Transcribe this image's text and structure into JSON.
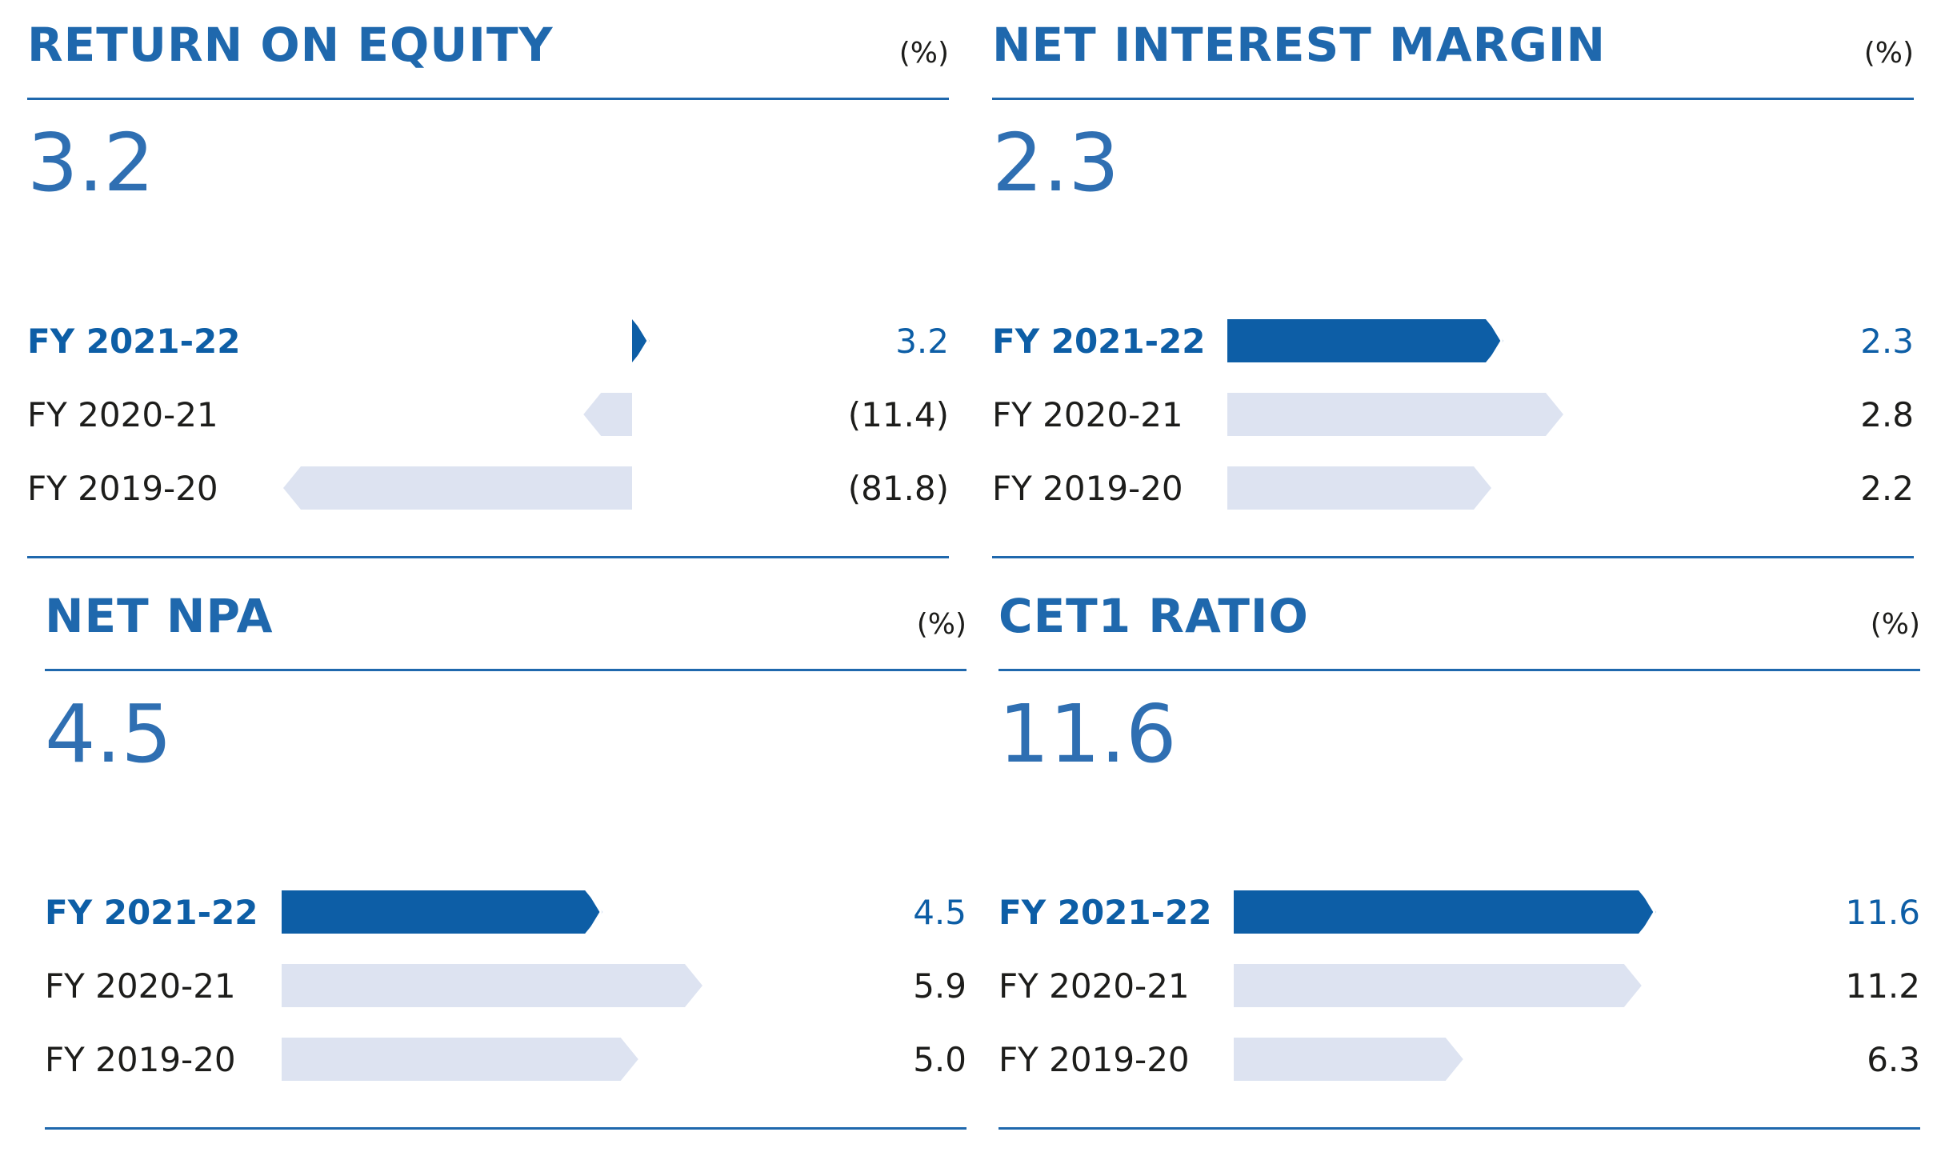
{
  "colors": {
    "accent": "#0d5ea6",
    "title": "#1f68ad",
    "kpi": "#2f6fb2",
    "bar_current": "#0d5ea6",
    "bar_past": "#dde3f1",
    "text_dark": "#1d1d1b",
    "rule": "#1f68ad"
  },
  "chart_data": [
    {
      "type": "bar",
      "title": "RETURN ON EQUITY",
      "unit": "(%)",
      "headline": "3.2",
      "categories": [
        "FY 2021-22",
        "FY 2020-21",
        "FY 2019-20"
      ],
      "values": [
        3.2,
        -11.4,
        -81.8
      ],
      "value_labels": [
        "3.2",
        "(11.4)",
        "(81.8)"
      ],
      "highlight_index": 0
    },
    {
      "type": "bar",
      "title": "NET INTEREST MARGIN",
      "unit": "(%)",
      "headline": "2.3",
      "categories": [
        "FY 2021-22",
        "FY 2020-21",
        "FY 2019-20"
      ],
      "values": [
        2.3,
        2.8,
        2.2
      ],
      "value_labels": [
        "2.3",
        "2.8",
        "2.2"
      ],
      "highlight_index": 0
    },
    {
      "type": "bar",
      "title": "NET NPA",
      "unit": "(%)",
      "headline": "4.5",
      "categories": [
        "FY 2021-22",
        "FY 2020-21",
        "FY 2019-20"
      ],
      "values": [
        4.5,
        5.9,
        5.0
      ],
      "value_labels": [
        "4.5",
        "5.9",
        "5.0"
      ],
      "highlight_index": 0
    },
    {
      "type": "bar",
      "title": "CET1 RATIO",
      "unit": "(%)",
      "headline": "11.6",
      "categories": [
        "FY 2021-22",
        "FY 2020-21",
        "FY 2019-20"
      ],
      "values": [
        11.6,
        11.2,
        6.3
      ],
      "value_labels": [
        "11.6",
        "11.2",
        "6.3"
      ],
      "highlight_index": 0
    }
  ]
}
